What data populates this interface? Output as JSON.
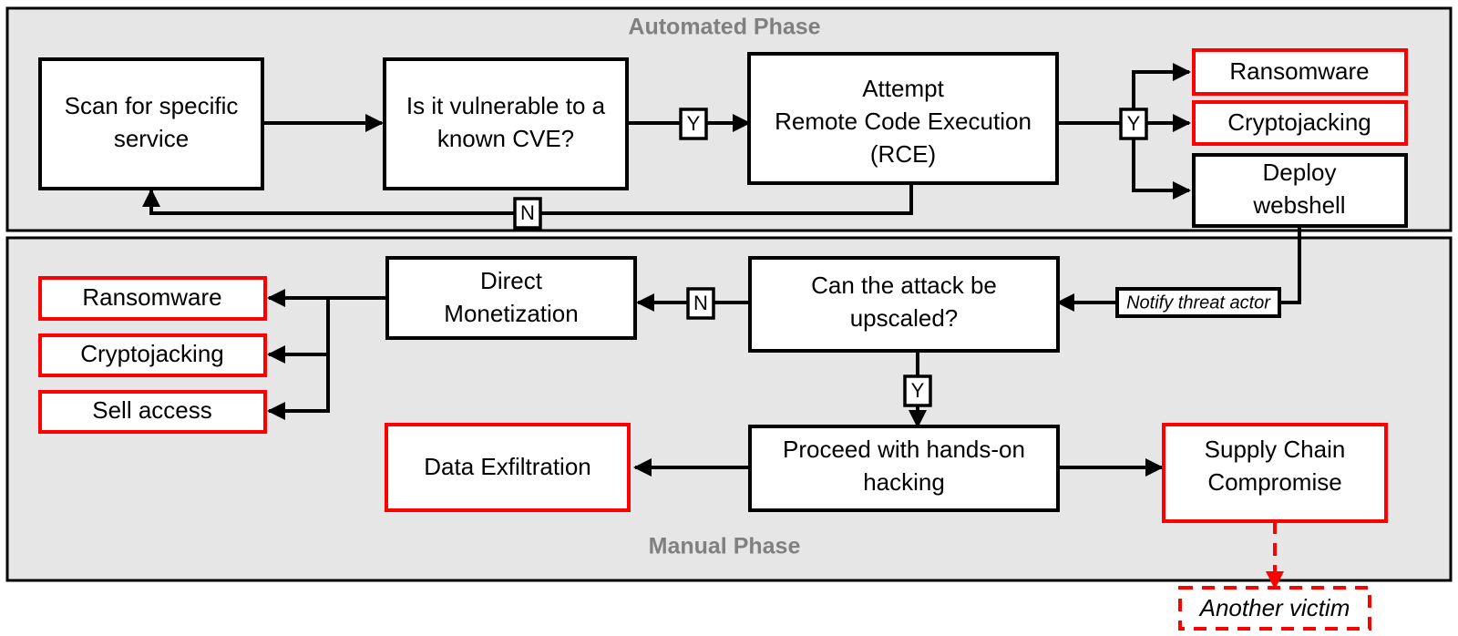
{
  "diagram": {
    "title": "Attack lifecycle flowchart",
    "colors": {
      "phase_fill": "#e6e6e6",
      "phase_stroke": "#000000",
      "phase_label": "#808080",
      "node_stroke": "#000000",
      "highlight_stroke": "#ff0000",
      "node_fill": "#ffffff"
    },
    "phases": [
      {
        "id": "automated",
        "label": "Automated Phase"
      },
      {
        "id": "manual",
        "label": "Manual Phase"
      }
    ],
    "nodes": {
      "scan": {
        "label_line1": "Scan for specific",
        "label_line2": "service"
      },
      "cve": {
        "label_line1": "Is it vulnerable to a",
        "label_line2": "known CVE?"
      },
      "rce": {
        "label_line1": "Attempt",
        "label_line2": "Remote Code Execution",
        "label_line3": "(RCE)"
      },
      "ransomware_auto": {
        "label": "Ransomware"
      },
      "cryptojacking_auto": {
        "label": "Cryptojacking"
      },
      "webshell": {
        "label_line1": "Deploy",
        "label_line2": "webshell"
      },
      "notify": {
        "label": "Notify threat actor"
      },
      "upscale": {
        "label_line1": "Can the attack be",
        "label_line2": "upscaled?"
      },
      "monetize": {
        "label_line1": "Direct",
        "label_line2": "Monetization"
      },
      "ransomware_manual": {
        "label": "Ransomware"
      },
      "cryptojacking_manual": {
        "label": "Cryptojacking"
      },
      "sell_access": {
        "label": "Sell access"
      },
      "hands_on": {
        "label_line1": "Proceed with hands-on",
        "label_line2": "hacking"
      },
      "data_exfil": {
        "label": "Data Exfiltration"
      },
      "supply_chain": {
        "label_line1": "Supply Chain",
        "label_line2": "Compromise"
      },
      "another_victim": {
        "label": "Another victim"
      }
    },
    "edge_tags": {
      "cve_yes": "Y",
      "cve_no": "N",
      "rce_yes": "Y",
      "upscale_no": "N",
      "upscale_yes": "Y"
    }
  }
}
